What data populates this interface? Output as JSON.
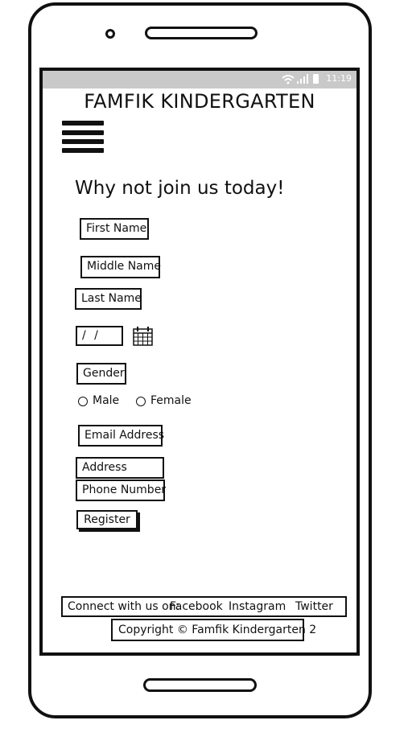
{
  "status": {
    "icons": "wifi-signal-battery",
    "time": "11:19"
  },
  "header": {
    "title": "FAMFIK KINDERGARTEN"
  },
  "form": {
    "heading": "Why not join us today!",
    "first_name": "First Name",
    "middle_name": "Middle Name",
    "last_name": "Last Name",
    "date_value": "/ /",
    "gender": "Gender",
    "gender_options": [
      "Male",
      "Female"
    ],
    "email": "Email Address",
    "address": "Address",
    "phone": "Phone Number",
    "register": "Register"
  },
  "footer": {
    "connect_label": "Connect with us on:",
    "links": [
      "Facebook",
      "Instagram",
      "Twitter"
    ],
    "copyright": "Copyright © Famfik Kindergarten 2"
  }
}
